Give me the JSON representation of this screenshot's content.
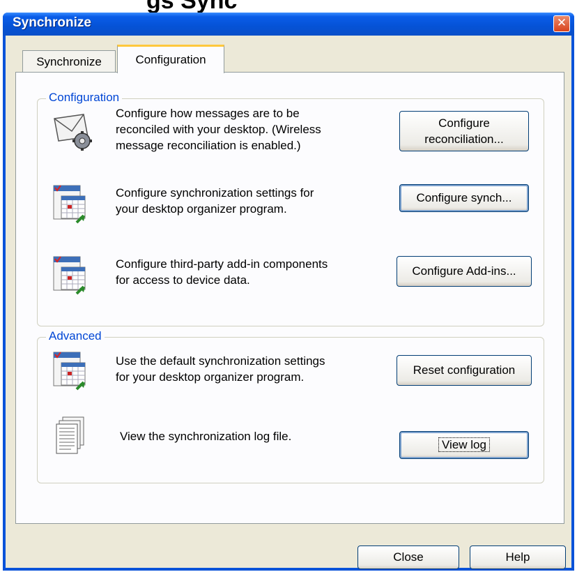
{
  "window": {
    "title": "Synchronize",
    "close_glyph": "✕"
  },
  "background_title": "gs  Sync",
  "tabs": [
    {
      "label": "Synchronize",
      "active": false
    },
    {
      "label": "Configuration",
      "active": true
    }
  ],
  "config_group": {
    "legend": "Configuration",
    "rows": [
      {
        "icon": "envelope-gear-icon",
        "desc": [
          "Configure how messages are to be",
          "reconciled with your desktop. (Wireless",
          "message reconciliation is enabled.)"
        ],
        "button": [
          "Configure",
          "reconciliation..."
        ]
      },
      {
        "icon": "calendar-icon",
        "desc": [
          "Configure synchronization settings for",
          "your desktop organizer program."
        ],
        "button": [
          "Configure synch..."
        ]
      },
      {
        "icon": "calendar-icon",
        "desc": [
          "Configure third-party add-in components",
          "for access to device data."
        ],
        "button": [
          "Configure Add-ins..."
        ]
      }
    ]
  },
  "advanced_group": {
    "legend": "Advanced",
    "rows": [
      {
        "icon": "calendar-icon",
        "desc": [
          "Use the default synchronization settings",
          "for your desktop organizer program."
        ],
        "button": [
          "Reset configuration"
        ]
      },
      {
        "icon": "log-file-icon",
        "desc": [
          "View the synchronization log file."
        ],
        "button": [
          "View log"
        ]
      }
    ]
  },
  "footer": {
    "close": "Close",
    "help": "Help"
  },
  "colors": {
    "titlebar": "#0552d6",
    "legend": "#0046d5",
    "tab_highlight": "#ffc83c",
    "dialog_bg": "#ece9d8"
  }
}
